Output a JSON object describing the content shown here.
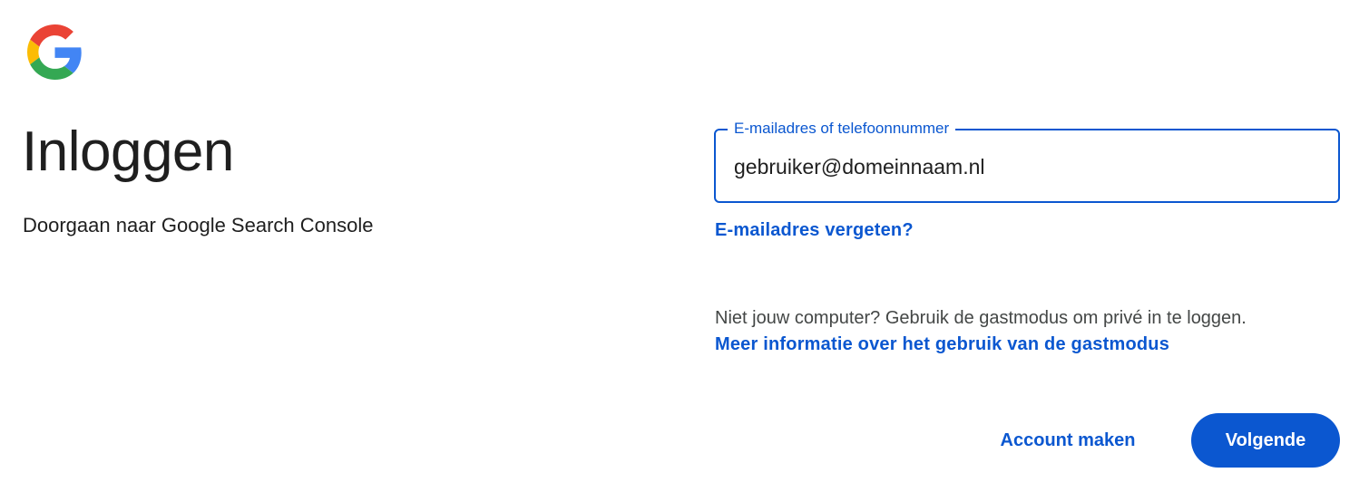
{
  "logo": {
    "icon": "google-g-icon"
  },
  "header": {
    "title": "Inloggen",
    "subtitle": "Doorgaan naar Google Search Console"
  },
  "login": {
    "field_label": "E-mailadres of telefoonnummer",
    "email_value": "gebruiker@domeinnaam.nl",
    "forgot_email": "E-mailadres vergeten?",
    "guest_text": "Niet jouw computer? Gebruik de gastmodus om privé in te loggen.",
    "guest_link": "Meer informatie over het gebruik van de gastmodus"
  },
  "actions": {
    "create_account": "Account maken",
    "next": "Volgende"
  },
  "colors": {
    "accent": "#0b57d0",
    "text": "#1f1f1f",
    "muted_text": "#444746",
    "google_blue": "#4285f4",
    "google_red": "#ea4335",
    "google_yellow": "#fbbc05",
    "google_green": "#34a853"
  }
}
